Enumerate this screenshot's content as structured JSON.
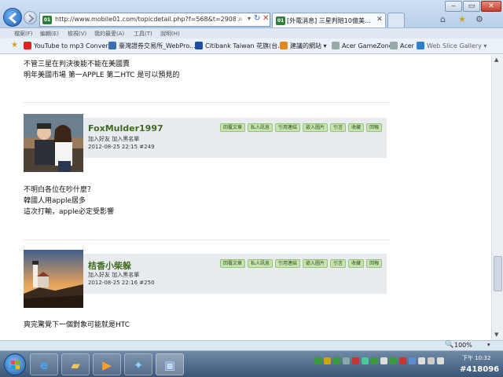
{
  "browser": {
    "address_url": "http://www.mobile01.com/topicdetail.php?f=568&t=2908466&",
    "tab_title": "[外電消息] 三星判賠10億美...",
    "zoom": "100%",
    "menu": [
      "檔案(F)",
      "編輯(E)",
      "檢視(V)",
      "我的最愛(A)",
      "工具(T)",
      "說明(H)"
    ],
    "favorites": [
      {
        "label": "YouTube to mp3 Conver...",
        "color": "#d22"
      },
      {
        "label": "臺灣證券交易所_WebPro...",
        "color": "#3a6fb0"
      },
      {
        "label": "Citibank Taiwan 花旗(台...",
        "color": "#1f4f9e"
      },
      {
        "label": "建議的網站 ▾",
        "color": "#e08a1e"
      },
      {
        "label": "Acer GameZone",
        "color": "#444"
      },
      {
        "label": "Acer",
        "color": "#444"
      },
      {
        "label": "Web Slice Gallery ▾",
        "color": "#2a7fd0"
      }
    ]
  },
  "posts": [
    {
      "text": [
        "不管三星在判決後能不能在美國賣",
        "明年美國市場 第一APPLE 第二HTC 是可以預見的"
      ]
    },
    {
      "author": {
        "name": "FoxMulder1997",
        "links": "加入好友  加入黑名單",
        "date": "2012-08-25 22:15  #249"
      },
      "text": [
        "不明白各位在吵什麼？",
        "韓國人用apple居多",
        "這次打輸，apple必定受影響"
      ]
    },
    {
      "author": {
        "name": "桔香小柴躲",
        "links": "加入好友  加入黑名單",
        "date": "2012-08-25 22:16  #250"
      },
      "text": [
        "爽完驚覺下一個對象可能就是HTC"
      ]
    }
  ],
  "post_buttons": [
    "回覆文章",
    "私人訊息",
    "引用連結",
    "嵌入圖片",
    "引言",
    "收藏",
    "回報"
  ],
  "taskbar": {
    "time": "下午 10:32",
    "id_label": "#418096"
  }
}
